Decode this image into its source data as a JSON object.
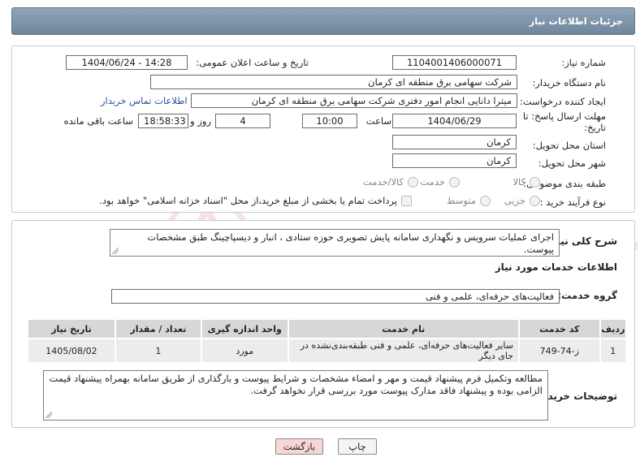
{
  "header": {
    "title": "جزئیات اطلاعات نیاز"
  },
  "form": {
    "need_number": {
      "label": "شماره نیاز:",
      "value": "1104001406000071"
    },
    "announce": {
      "label": "تاریخ و ساعت اعلان عمومی:",
      "value": "1404/06/24 - 14:28"
    },
    "buyer_org": {
      "label": "نام دستگاه خریدار:",
      "value": "شرکت سهامی برق منطقه ای کرمان"
    },
    "requester": {
      "label": "ایجاد کننده درخواست:",
      "value": "میترا دانایی انجام امور دفتری شرکت سهامی برق منطقه ای کرمان",
      "contact_link": "اطلاعات تماس خریدار"
    },
    "deadline": {
      "label_line1": "مهلت ارسال پاسخ: تا",
      "label_line2": "تاریخ:",
      "date": "1404/06/29",
      "time_label": "ساعت",
      "time": "10:00",
      "days": "4",
      "days_label": "روز و",
      "remaining": "18:58:33",
      "remaining_label": "ساعت باقی مانده"
    },
    "province": {
      "label": "استان محل تحویل:",
      "value": "کرمان"
    },
    "city": {
      "label": "شهر محل تحویل:",
      "value": "کرمان"
    },
    "category": {
      "label": "طبقه بندی موضوعی:",
      "options": [
        "کالا",
        "خدمت",
        "کالا/خدمت"
      ]
    },
    "purchase_type": {
      "label": "نوع فرآیند خرید :",
      "options": [
        "جزیی",
        "متوسط"
      ],
      "payment_note": "پرداخت تمام یا بخشی از مبلغ خرید،از محل \"اسناد خزانه اسلامی\" خواهد بود."
    }
  },
  "description": {
    "label": "شرح کلی نیاز:",
    "value": "اجرای عملیات سرویس و نگهداری سامانه پایش تصویری حوزه ستادی ، انبار و دیسپاچینگ طبق مشخصات پیوست."
  },
  "services": {
    "title": "اطلاعات خدمات مورد نیاز",
    "group_label": "گروه خدمت:",
    "group_value": "فعالیت‌های حرفه‌ای، علمی و فنی",
    "columns": [
      "ردیف",
      "کد خدمت",
      "نام خدمت",
      "واحد اندازه گیری",
      "تعداد / مقدار",
      "تاریخ نیاز"
    ],
    "rows": [
      {
        "row": "1",
        "code": "ز-74-749",
        "name": "سایر فعالیت‌های حرفه‌ای، علمی و فنی طبقه‌بندی‌نشده در جای دیگر",
        "unit": "مورد",
        "qty": "1",
        "date": "1405/08/02"
      }
    ]
  },
  "buyer_notes": {
    "label": "توضیحات خریدار:",
    "value": "مطالعه وتکمیل فرم پیشنهاد قیمت و مهر و امضاء مشخصات و شرایط پیوست و بارگذاری از طریق سامانه بهمراه پیشنهاد قیمت الزامی بوده و پیشنهاد فاقد مدارک پیوست مورد بررسی قرار نخواهد گرفت."
  },
  "buttons": {
    "print": "چاپ",
    "back": "بازگشت"
  },
  "colors": {
    "header": "#7a90a5",
    "link": "#2453a3",
    "back_button": "#f6d6d6",
    "watermark": "#c0392b"
  }
}
